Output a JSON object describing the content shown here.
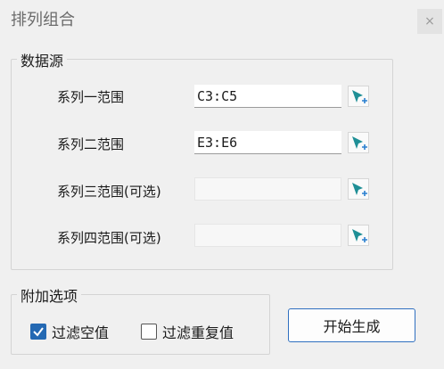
{
  "window": {
    "title": "排列组合",
    "close_symbol": "×"
  },
  "data_source": {
    "label": "数据源",
    "rows": [
      {
        "label": "系列一范围",
        "value": "C3:C5",
        "enabled": true,
        "icon": "range-select-icon"
      },
      {
        "label": "系列二范围",
        "value": "E3:E6",
        "enabled": true,
        "icon": "range-select-icon"
      },
      {
        "label": "系列三范围(可选)",
        "value": "",
        "enabled": false,
        "icon": "range-select-icon"
      },
      {
        "label": "系列四范围(可选)",
        "value": "",
        "enabled": false,
        "icon": "range-select-icon"
      }
    ]
  },
  "options": {
    "label": "附加选项",
    "filter_empty": {
      "label": "过滤空值",
      "checked": true
    },
    "filter_duplicates": {
      "label": "过滤重复值",
      "checked": false
    }
  },
  "actions": {
    "start_label": "开始生成"
  },
  "colors": {
    "accent": "#2469b3",
    "icon_teal": "#1f8f96",
    "icon_plus": "#2a7fd0"
  }
}
